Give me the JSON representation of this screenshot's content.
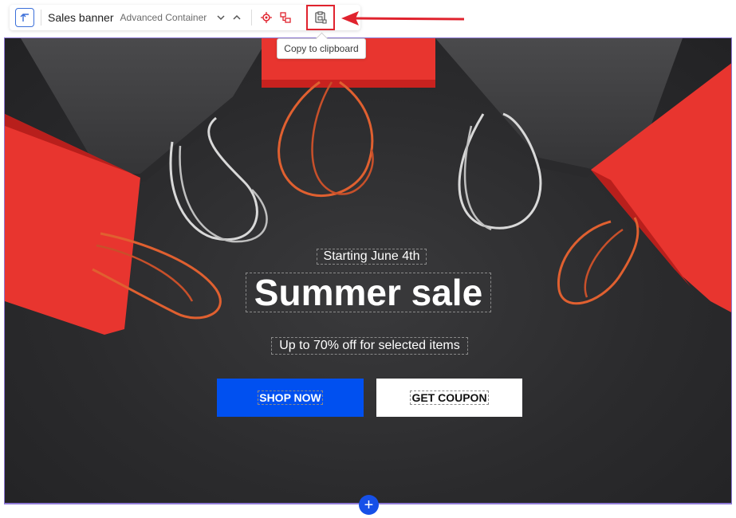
{
  "toolbar": {
    "title": "Sales banner",
    "subtitle": "Advanced Container",
    "icons": {
      "parent": "select-parent-icon",
      "collapse": "chevron-down-icon",
      "expand": "chevron-up-icon",
      "locate": "target-icon",
      "structure": "structure-icon",
      "copy": "clipboard-icon"
    }
  },
  "tooltip": {
    "text": "Copy to clipboard"
  },
  "banner": {
    "eyebrow": "Starting June 4th",
    "headline": "Summer sale",
    "subline": "Up to 70% off for selected items",
    "primary_button": "SHOP NOW",
    "secondary_button": "GET COUPON"
  },
  "add_button": {
    "label": "+"
  },
  "colors": {
    "accent_blue": "#0050f0",
    "annotation_red": "#e0232e",
    "bag_red": "#e8352f",
    "bag_grey": "#3f3f41",
    "background": "#2b2b2d",
    "selection_outline": "#8f7ad6"
  }
}
